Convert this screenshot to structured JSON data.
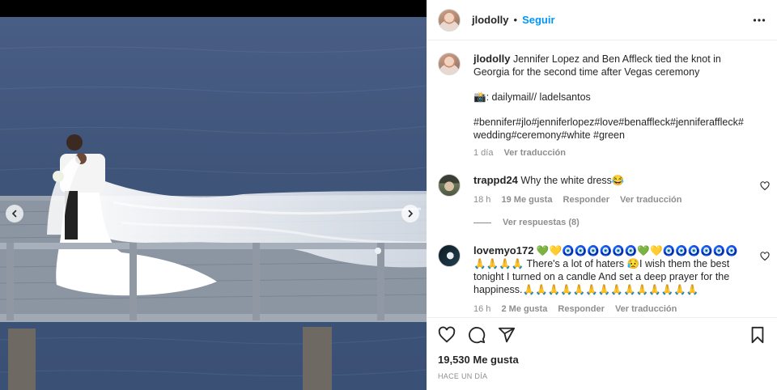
{
  "post": {
    "username": "jlodolly",
    "separator": "•",
    "follow_label": "Seguir",
    "caption_text": "Jennifer Lopez and Ben Affleck tied the knot in Georgia for the second time after Vegas ceremony",
    "credit": "📸: dailymail// ladelsantos",
    "hashtags": "#bennifer#jlo#jenniferlopez#love#benaffleck#jenniferaffleck#wedding#ceremony#white #green",
    "time": "1 día",
    "see_translation": "Ver traducción"
  },
  "comments": [
    {
      "username": "trappd24",
      "text": "Why the white dress😂",
      "time": "18 h",
      "likes": "19 Me gusta",
      "reply": "Responder",
      "translate": "Ver traducción",
      "view_replies": "Ver respuestas (8)"
    },
    {
      "username": "lovemyo172",
      "text": "💚💛🧿🧿🧿🧿🧿🧿💚💛🧿🧿🧿🧿🧿🧿🙏🙏🙏🙏 There's a lot of haters 😥I wish them the best tonight I turned on a candle And set a deep prayer for the happiness.🙏🙏🙏🙏🙏🙏🙏🙏🙏🙏🙏🙏🙏🙏",
      "time": "16 h",
      "likes": "2 Me gusta",
      "reply": "Responder",
      "translate": "Ver traducción"
    }
  ],
  "actions": {
    "likes_count": "19,530 Me gusta",
    "posted": "HACE UN DÍA"
  },
  "colors": {
    "link": "#0095f6",
    "hashtag": "#00376b",
    "muted": "#8e8e8e",
    "water": "#3f5479"
  },
  "icons": [
    "heart-icon",
    "comment-icon",
    "share-icon",
    "bookmark-icon",
    "more-icon",
    "chevron-left-icon",
    "chevron-right-icon"
  ]
}
